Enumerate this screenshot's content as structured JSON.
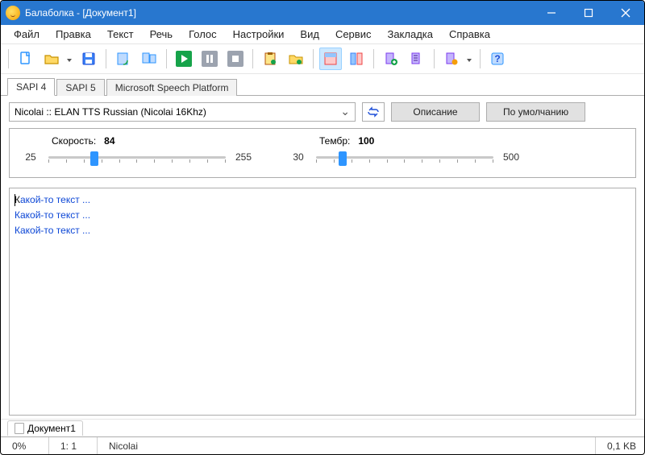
{
  "window": {
    "title": "Балаболка - [Документ1]"
  },
  "menu": {
    "items": [
      "Файл",
      "Правка",
      "Текст",
      "Речь",
      "Голос",
      "Настройки",
      "Вид",
      "Сервис",
      "Закладка",
      "Справка"
    ]
  },
  "tabs": {
    "items": [
      "SAPI 4",
      "SAPI 5",
      "Microsoft Speech Platform"
    ],
    "active": 0
  },
  "voice": {
    "selected": "Nicolai :: ELAN TTS Russian (Nicolai 16Khz)",
    "describe_btn": "Описание",
    "default_btn": "По умолчанию"
  },
  "sliders": {
    "speed": {
      "label": "Скорость:",
      "value": "84",
      "min": "25",
      "max": "255"
    },
    "pitch": {
      "label": "Тембр:",
      "value": "100",
      "min": "30",
      "max": "500"
    }
  },
  "editor": {
    "lines": [
      {
        "black": "К",
        "blue": "акой-то текст ..."
      },
      {
        "black": "",
        "blue": "Какой-то текст ..."
      },
      {
        "black": "",
        "blue": "Какой-то текст ..."
      }
    ]
  },
  "doctab": {
    "label": "Документ1"
  },
  "status": {
    "progress": "0%",
    "position": "1:  1",
    "voice": "Nicolai",
    "size": "0,1 KB"
  },
  "colors": {
    "accent": "#2877cf",
    "link": "#0d47d6"
  }
}
